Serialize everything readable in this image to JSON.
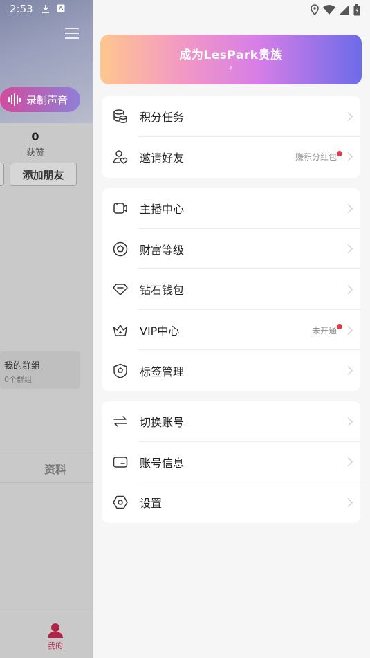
{
  "status_bar": {
    "time": "2:53"
  },
  "background_page": {
    "record_button_label": "录制声音",
    "likes_count": "0",
    "likes_label": "获赞",
    "add_friend_label": "添加朋友",
    "group": {
      "title": "我的群组",
      "subtitle": "0个群组"
    },
    "tab_label": "资料",
    "nav_mine_label": "我的"
  },
  "drawer": {
    "banner": {
      "title": "成为LesPark贵族",
      "arrow": "›"
    },
    "sections": [
      {
        "items": [
          {
            "label": "积分任务",
            "icon": "coins-stack-icon"
          },
          {
            "label": "邀请好友",
            "icon": "invite-friend-icon",
            "right_text": "赚积分红包",
            "dot": true
          }
        ]
      },
      {
        "items": [
          {
            "label": "主播中心",
            "icon": "video-camera-icon"
          },
          {
            "label": "财富等级",
            "icon": "wealth-pentagon-icon"
          },
          {
            "label": "钻石钱包",
            "icon": "diamond-icon"
          },
          {
            "label": "VIP中心",
            "icon": "crown-icon",
            "right_text": "未开通",
            "dot": true
          },
          {
            "label": "标签管理",
            "icon": "shield-tag-icon"
          }
        ]
      },
      {
        "items": [
          {
            "label": "切换账号",
            "icon": "switch-arrows-icon"
          },
          {
            "label": "账号信息",
            "icon": "card-icon"
          },
          {
            "label": "设置",
            "icon": "hexagon-settings-icon"
          }
        ]
      }
    ]
  },
  "colors": {
    "accent_red": "#e23b4f",
    "banner_gradient": [
      "#ffc78e",
      "#f39ac2",
      "#d77ee7",
      "#6d6be8"
    ],
    "record_gradient": [
      "#d24b9d",
      "#8f7fd8"
    ]
  }
}
